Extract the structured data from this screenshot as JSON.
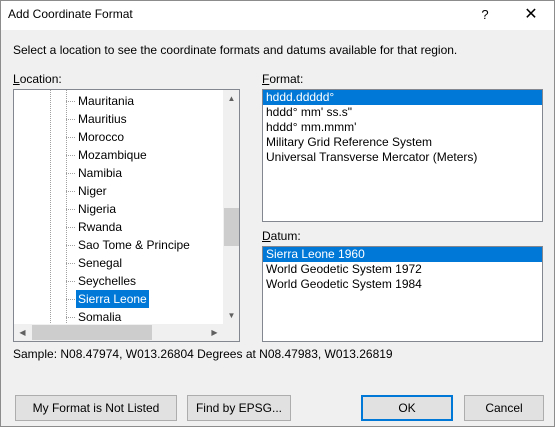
{
  "window": {
    "title": "Add Coordinate Format",
    "help_glyph": "?",
    "close_glyph": "✕"
  },
  "instructions": "Select a location to see the coordinate formats and datums available for that region.",
  "location": {
    "label_mnemonic": "L",
    "label_rest": "ocation:",
    "items": [
      {
        "label": "Mauritania"
      },
      {
        "label": "Mauritius"
      },
      {
        "label": "Morocco"
      },
      {
        "label": "Mozambique"
      },
      {
        "label": "Namibia"
      },
      {
        "label": "Niger"
      },
      {
        "label": "Nigeria"
      },
      {
        "label": "Rwanda"
      },
      {
        "label": "Sao Tome & Principe"
      },
      {
        "label": "Senegal"
      },
      {
        "label": "Seychelles"
      },
      {
        "label": "Sierra Leone"
      },
      {
        "label": "Somalia"
      }
    ],
    "selected_label": "Sierra Leone"
  },
  "format": {
    "label_mnemonic": "F",
    "label_rest": "ormat:",
    "items": [
      {
        "label": "hddd.ddddd°"
      },
      {
        "label": "hddd° mm' ss.s\""
      },
      {
        "label": "hddd° mm.mmm'"
      },
      {
        "label": "Military Grid Reference System"
      },
      {
        "label": "Universal Transverse Mercator (Meters)"
      }
    ],
    "selected_label": "hddd.ddddd°"
  },
  "datum": {
    "label_mnemonic": "D",
    "label_rest": "atum:",
    "items": [
      {
        "label": "Sierra Leone 1960"
      },
      {
        "label": "World Geodetic System 1972"
      },
      {
        "label": "World Geodetic System 1984"
      }
    ],
    "selected_label": "Sierra Leone 1960"
  },
  "sample": "Sample: N08.47974, W013.26804 Degrees at N08.47983, W013.26819",
  "buttons": {
    "not_listed": "My Format is Not Listed",
    "find_epsg": "Find by EPSG...",
    "ok": "OK",
    "cancel": "Cancel"
  },
  "scroll_glyphs": {
    "up": "▲",
    "down": "▼",
    "left": "◀",
    "right": "▶"
  },
  "colors": {
    "selection": "#0078d7",
    "dialog_bg": "#f0f0f0"
  }
}
